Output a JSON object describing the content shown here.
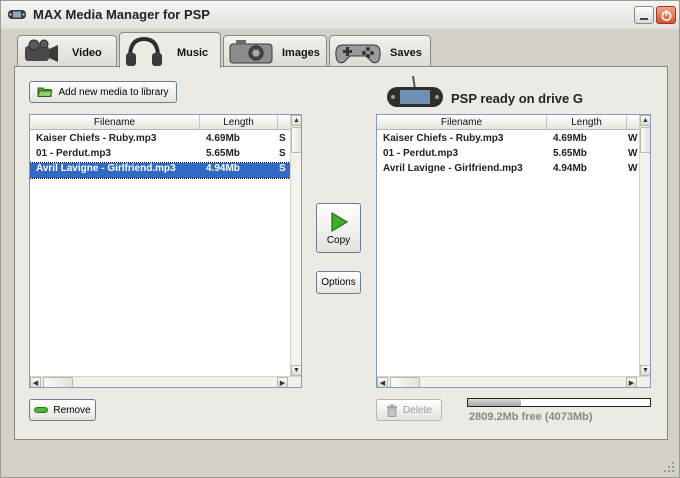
{
  "window": {
    "title": "MAX Media Manager for PSP"
  },
  "tabs": [
    {
      "label": "Video",
      "icon": "video-camera-icon"
    },
    {
      "label": "Music",
      "icon": "headphones-icon"
    },
    {
      "label": "Images",
      "icon": "camera-icon"
    },
    {
      "label": "Saves",
      "icon": "gamepad-icon"
    }
  ],
  "active_tab": "Music",
  "library": {
    "add_button": "Add new media to library",
    "columns": [
      "Filename",
      "Length",
      ""
    ],
    "rows": [
      {
        "filename": "Kaiser Chiefs - Ruby.mp3",
        "length": "4.69Mb",
        "extra": "S",
        "selected": false
      },
      {
        "filename": "01 - Perdut.mp3",
        "length": "5.65Mb",
        "extra": "S",
        "selected": false
      },
      {
        "filename": "Avril Lavigne - Girlfriend.mp3",
        "length": "4.94Mb",
        "extra": "S",
        "selected": true
      }
    ],
    "remove_button": "Remove"
  },
  "actions": {
    "copy_label": "Copy",
    "options_label": "Options"
  },
  "device": {
    "status": "PSP ready on drive G",
    "columns": [
      "Filename",
      "Length",
      ""
    ],
    "rows": [
      {
        "filename": "Kaiser Chiefs - Ruby.mp3",
        "length": "4.69Mb",
        "extra": "W"
      },
      {
        "filename": "01 - Perdut.mp3",
        "length": "5.65Mb",
        "extra": "W"
      },
      {
        "filename": "Avril Lavigne - Girlfriend.mp3",
        "length": "4.94Mb",
        "extra": "W"
      }
    ],
    "delete_button": "Delete",
    "free_space": "2809.2Mb free (4073Mb)",
    "used_fraction": 0.29
  },
  "colors": {
    "selection": "#316ac5",
    "panel": "#eceae4",
    "frame": "#d4d0c8"
  }
}
